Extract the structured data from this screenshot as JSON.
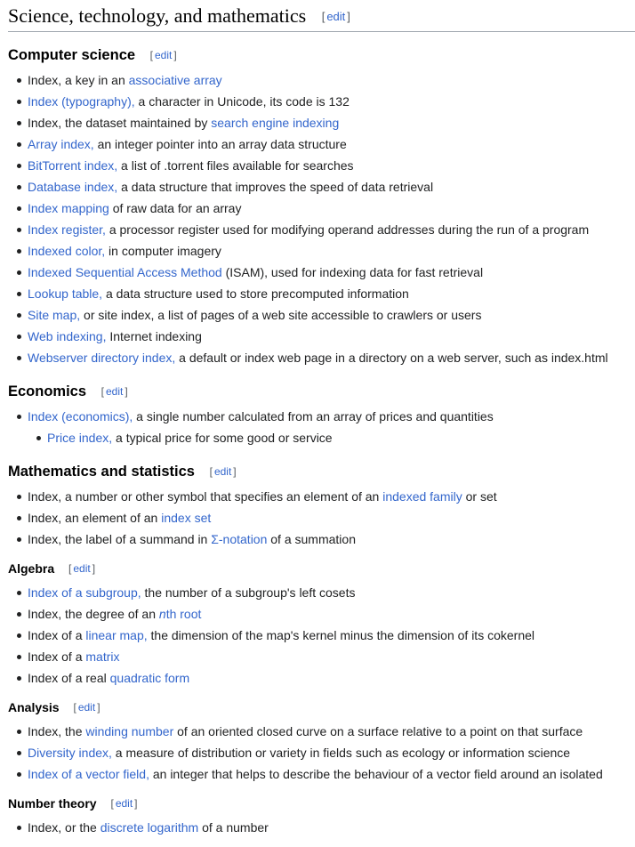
{
  "section": {
    "title": "Science, technology, and mathematics",
    "edit_label": "edit"
  },
  "subsections": {
    "computer_science": {
      "title": "Computer science",
      "edit_label": "edit",
      "items": [
        {
          "pre": "Index, a key in an ",
          "link": "associative array",
          "post": ""
        },
        {
          "pre": "",
          "link": "Index (typography),",
          "post": " a character in Unicode, its code is 132"
        },
        {
          "pre": "Index, the dataset maintained by ",
          "link": "search engine indexing",
          "post": ""
        },
        {
          "pre": "",
          "link": "Array index,",
          "post": " an integer pointer into an array data structure"
        },
        {
          "pre": "",
          "link": "BitTorrent index,",
          "post": " a list of .torrent files available for searches"
        },
        {
          "pre": "",
          "link": "Database index,",
          "post": " a data structure that improves the speed of data retrieval"
        },
        {
          "pre": "",
          "link": "Index mapping",
          "post": " of raw data for an array"
        },
        {
          "pre": "",
          "link": "Index register,",
          "post": " a processor register used for modifying operand addresses during the run of a program"
        },
        {
          "pre": "",
          "link": "Indexed color,",
          "post": " in computer imagery"
        },
        {
          "pre": "",
          "link": "Indexed Sequential Access Method",
          "post": " (ISAM), used for indexing data for fast retrieval"
        },
        {
          "pre": "",
          "link": "Lookup table,",
          "post": " a data structure used to store precomputed information"
        },
        {
          "pre": "",
          "link": "Site map,",
          "post": " or site index, a list of pages of a web site accessible to crawlers or users"
        },
        {
          "pre": "",
          "link": "Web indexing,",
          "post": " Internet indexing"
        },
        {
          "pre": "",
          "link": "Webserver directory index,",
          "post": " a default or index web page in a directory on a web server, such as index.html"
        }
      ]
    },
    "economics": {
      "title": "Economics",
      "edit_label": "edit",
      "items": [
        {
          "pre": "",
          "link": "Index (economics),",
          "post": " a single number calculated from an array of prices and quantities"
        }
      ],
      "subitems": [
        {
          "pre": "",
          "link": "Price index,",
          "post": " a typical price for some good or service"
        }
      ]
    },
    "math_stats": {
      "title": "Mathematics and statistics",
      "edit_label": "edit",
      "items": [
        {
          "pre": "Index, a number or other symbol that specifies an element of an ",
          "link": "indexed family",
          "post": " or set"
        },
        {
          "pre": "Index, an element of an ",
          "link": "index set",
          "post": ""
        },
        {
          "pre": "Index, the label of a summand in ",
          "link": "Σ-notation",
          "post": " of a summation"
        }
      ]
    },
    "algebra": {
      "title": "Algebra",
      "edit_label": "edit",
      "items": [
        {
          "pre": "",
          "link": "Index of a subgroup,",
          "post": " the number of a subgroup's left cosets"
        },
        {
          "pre": "Index, the degree of an ",
          "link_italic": "n",
          "link": "th root",
          "post": ""
        },
        {
          "pre": "Index of a ",
          "link": "linear map,",
          "post": " the dimension of the map's kernel minus the dimension of its cokernel"
        },
        {
          "pre": "Index of a ",
          "link": "matrix",
          "post": ""
        },
        {
          "pre": "Index of a real ",
          "link": "quadratic form",
          "post": ""
        }
      ]
    },
    "analysis": {
      "title": "Analysis",
      "edit_label": "edit",
      "items": [
        {
          "pre": "Index, the ",
          "link": "winding number",
          "post": " of an oriented closed curve on a surface relative to a point on that surface"
        },
        {
          "pre": "",
          "link": "Diversity index,",
          "post": " a measure of distribution or variety in fields such as ecology or information science"
        },
        {
          "pre": "",
          "link": "Index of a vector field,",
          "post": " an integer that helps to describe the behaviour of a vector field around an isolated"
        }
      ]
    },
    "number_theory": {
      "title": "Number theory",
      "edit_label": "edit",
      "items": [
        {
          "pre": "Index, or the ",
          "link": "discrete logarithm",
          "post": " of a number"
        }
      ]
    }
  },
  "colors": {
    "link": "#3366cc",
    "visited_link": "#3c3b8c",
    "text": "#202122",
    "rule": "#a2a9b1"
  }
}
